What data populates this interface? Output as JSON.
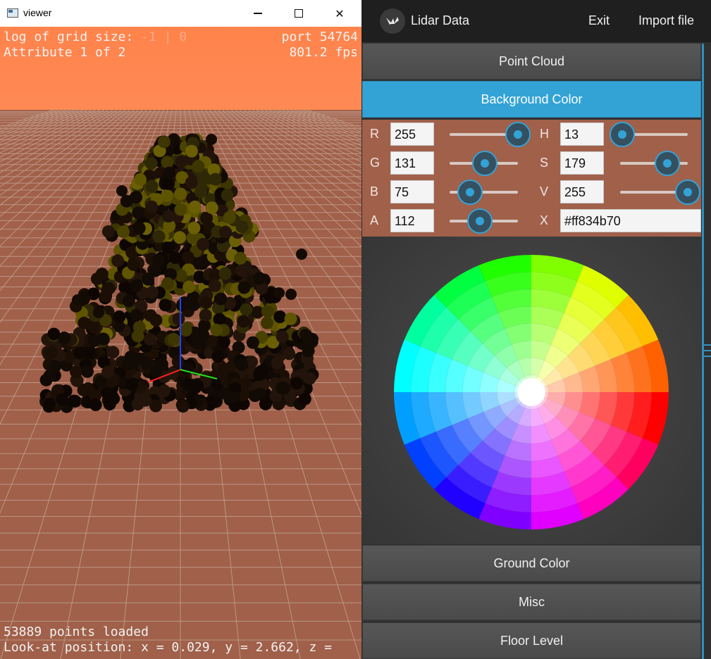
{
  "viewer": {
    "title": "viewer",
    "window_controls": {
      "minimize": "minimize-icon",
      "maximize": "maximize-icon",
      "close": "close-icon"
    },
    "hud": {
      "grid_label": "log of grid size: ",
      "grid_value": "-1 | 0",
      "port": "port 54764",
      "attribute": "Attribute 1 of 2",
      "fps": "801.2 fps",
      "points_loaded": "53889 points loaded",
      "look_at": "Look-at position: x = 0.029, y = 2.662, z ="
    },
    "colors": {
      "sky": "#ff834b",
      "ground": "#a0604a",
      "grid": "#c8a898",
      "axis_x": "#ff2020",
      "axis_y": "#20e020",
      "axis_z": "#2040ff",
      "points_dark": "#1a0e05",
      "points_light": "#5f5500"
    }
  },
  "app": {
    "title": "Lidar Data",
    "logo_icon": "kivy-logo-icon",
    "exit_label": "Exit",
    "import_label": "Import file",
    "accordion": {
      "point_cloud": "Point Cloud",
      "background_color": "Background Color",
      "ground_color": "Ground Color",
      "misc": "Misc",
      "floor_level": "Floor Level"
    },
    "picker": {
      "r_label": "R",
      "r_value": "255",
      "r_fraction": 1.0,
      "g_label": "G",
      "g_value": "131",
      "g_fraction": 0.514,
      "b_label": "B",
      "b_value": "75",
      "b_fraction": 0.294,
      "a_label": "A",
      "a_value": "112",
      "a_fraction": 0.439,
      "h_label": "H",
      "h_value": "13",
      "h_fraction": 0.036,
      "s_label": "S",
      "s_value": "179",
      "s_fraction": 0.702,
      "v_label": "V",
      "v_value": "255",
      "v_fraction": 1.0,
      "x_label": "X",
      "x_value": "#ff834b70"
    },
    "colors": {
      "accent": "#33a3d6",
      "panel": "#a0604a",
      "header": "#1f1f1f"
    }
  }
}
